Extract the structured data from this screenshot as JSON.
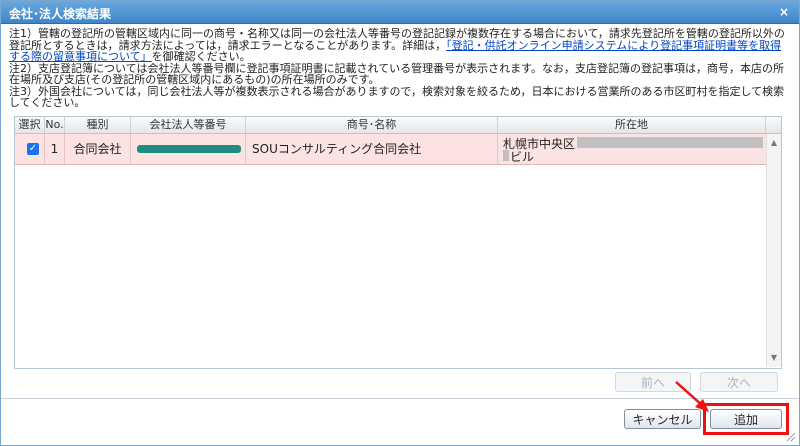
{
  "dialog": {
    "title": "会社･法人検索結果",
    "close_glyph": "×"
  },
  "notes": {
    "note1_text": "注1）管轄の登記所の管轄区域内に同一の商号・名称又は同一の会社法人等番号の登記記録が複数存在する場合において，請求先登記所を管轄の登記所以外の登記所とするときは，請求方法によっては，請求エラーとなることがあります。詳細は，",
    "note1_link": "「登記・供託オンライン申請システムにより登記事項証明書等を取得する際の留意事項について」",
    "note1_tail": "を御確認ください。",
    "note2": "注2）支店登記簿については会社法人等番号欄に登記事項証明書に記載されている管理番号が表示されます。なお，支店登記簿の登記事項は，商号，本店の所在場所及び支店(その登記所の管轄区域内にあるもの)の所在場所のみです。",
    "note3": "注3）外国会社については，同じ会社法人等が複数表示される場合がありますので，検索対象を絞るため，日本における営業所のある市区町村を指定して検索してください。"
  },
  "table": {
    "columns": [
      "選択",
      "No.",
      "種別",
      "会社法人等番号",
      "商号･名称",
      "所在地"
    ],
    "rows": [
      {
        "selected": true,
        "no": "1",
        "kind": "合同会社",
        "corp_number": "",
        "name": "SOUコンサルティング合同会社",
        "address_line1": "札幌市中央区",
        "address_line2": "ビル"
      }
    ]
  },
  "pagination": {
    "prev_label": "前へ",
    "next_label": "次へ"
  },
  "footer": {
    "cancel_label": "キャンセル",
    "add_label": "追加"
  },
  "colors": {
    "accent": "#3f86c9",
    "row_highlight": "#fbe3e3",
    "annotation": "#e11111"
  },
  "icons": [
    "close-icon",
    "check-icon",
    "scroll-up-icon",
    "scroll-down-icon",
    "resize-grip-icon",
    "annotation-arrow"
  ]
}
